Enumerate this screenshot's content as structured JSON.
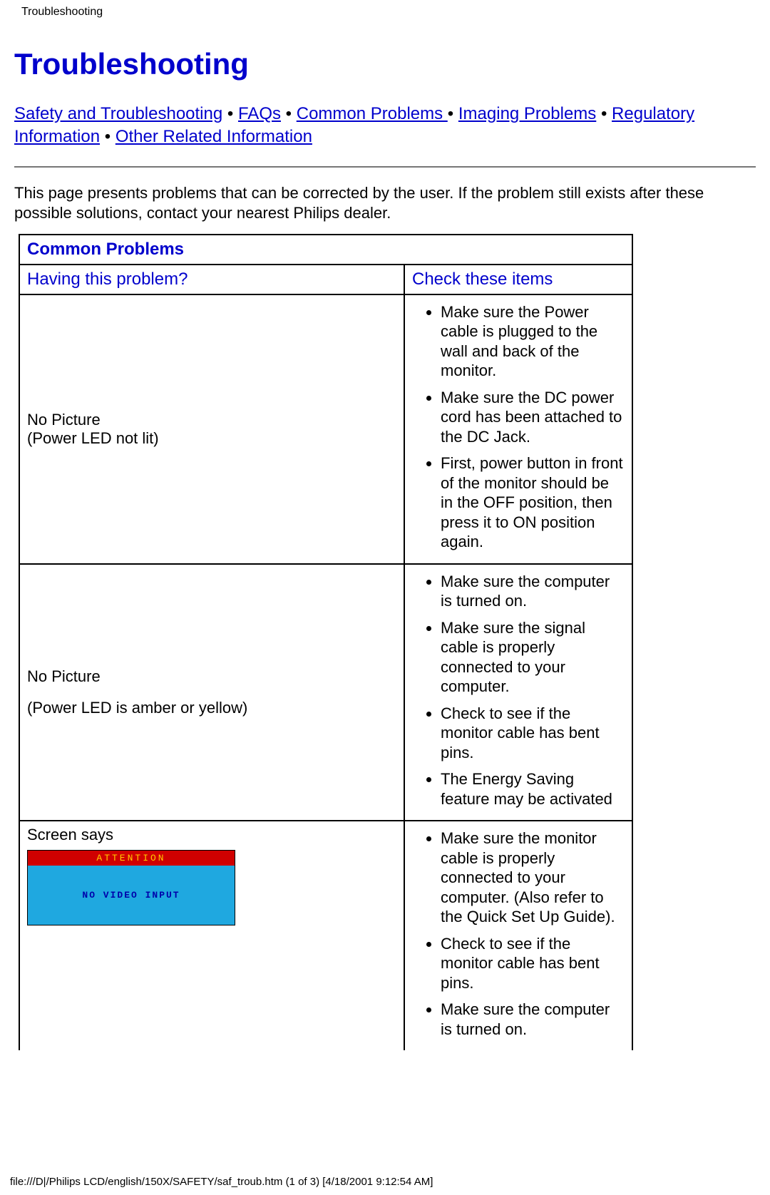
{
  "header": {
    "title": "Troubleshooting"
  },
  "page": {
    "heading": "Troubleshooting",
    "nav": {
      "links": {
        "safety": "Safety and Troubleshooting",
        "faqs": "FAQs",
        "common": "Common Problems ",
        "imaging": "Imaging Problems",
        "regulatory": "Regulatory Information",
        "other": "Other Related Information"
      },
      "sep": " • "
    },
    "intro": "This page presents problems that can be corrected by the user. If the problem still exists after these possible solutions, contact your nearest Philips dealer.",
    "table": {
      "section_title": "Common Problems",
      "left_header": "Having this problem?",
      "right_header": "Check these items",
      "rows": [
        {
          "problem_line1": "No Picture",
          "problem_line2": "(Power LED not lit)",
          "checks": [
            "Make sure the Power cable is plugged to the wall and back of the monitor.",
            "Make sure the DC power cord has been attached to the DC Jack.",
            "First, power button in front of the monitor should be in the OFF position, then press it to ON position again."
          ]
        },
        {
          "problem_line1": "No Picture",
          "problem_line2": "(Power LED is amber or yellow)",
          "checks": [
            "Make sure the computer is turned on.",
            "Make sure the signal cable is properly connected to your computer.",
            "Check to see if the monitor cable has bent pins.",
            "The Energy Saving feature may be activated"
          ]
        },
        {
          "problem_line1": "Screen says",
          "attention": {
            "head": "ATTENTION",
            "body": "NO VIDEO INPUT"
          },
          "checks": [
            "Make sure the monitor cable is properly connected to your computer. (Also refer to the Quick Set Up Guide).",
            "Check to see if the monitor cable has bent pins.",
            "Make sure the computer is turned on."
          ]
        }
      ]
    }
  },
  "footer": {
    "text": "file:///D|/Philips LCD/english/150X/SAFETY/saf_troub.htm (1 of 3) [4/18/2001 9:12:54 AM]"
  }
}
